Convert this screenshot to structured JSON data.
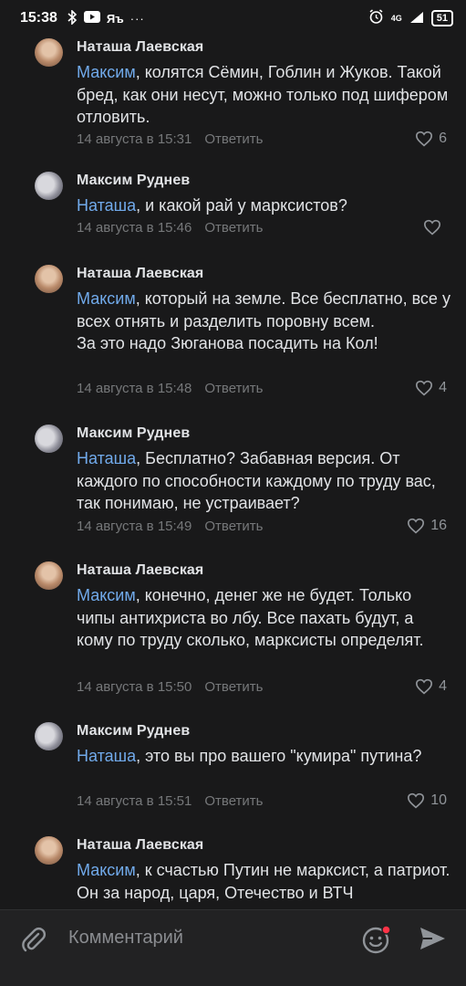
{
  "status_bar": {
    "time": "15:38",
    "icons_left": [
      "bluetooth-icon",
      "youtube-icon",
      "yandex-icon",
      "more-dots-icon"
    ],
    "network": "4G",
    "battery": "51"
  },
  "comments": [
    {
      "author": "Наташа Лаевская",
      "mention": "Максим",
      "text": ", колятся Сёмин, Гоблин и Жуков. Такой бред, как они несут, можно только под шифером отловить.",
      "time": "14 августа в 15:31",
      "reply": "Ответить",
      "likes": "6"
    },
    {
      "author": "Максим Руднев",
      "mention": "Наташа",
      "text": ", и какой рай у марксистов?",
      "time": "14 августа в 15:46",
      "reply": "Ответить",
      "likes": ""
    },
    {
      "author": "Наташа Лаевская",
      "mention": "Максим",
      "text": ", который на земле. Все бесплатно, все  у всех отнять и разделить поровну всем.\nЗа это надо Зюганова посадить на Кол!",
      "time": "14 августа в 15:48",
      "reply": "Ответить",
      "likes": "4"
    },
    {
      "author": "Максим Руднев",
      "mention": "Наташа",
      "text": ", Бесплатно? Забавная версия. От каждого по способности каждому по труду вас, так понимаю, не устраивает?",
      "time": "14 августа в 15:49",
      "reply": "Ответить",
      "likes": "16"
    },
    {
      "author": "Наташа Лаевская",
      "mention": "Максим",
      "text": ", конечно, денег же не будет. Только чипы антихриста во лбу. Все пахать будут, а кому по труду сколько, марксисты определят.",
      "time": "14 августа в 15:50",
      "reply": "Ответить",
      "likes": "4"
    },
    {
      "author": "Максим Руднев",
      "mention": "Наташа",
      "text": ", это вы про вашего \"кумира\" путина?",
      "time": "14 августа в 15:51",
      "reply": "Ответить",
      "likes": "10"
    },
    {
      "author": "Наташа Лаевская",
      "mention": "Максим",
      "text": ", к счастью Путин не марксист, а патриот. Он за народ, царя, Отечество и ВТЧ",
      "time": "",
      "reply": "",
      "likes": ""
    }
  ],
  "input": {
    "placeholder": "Комментарий"
  },
  "colors": {
    "background": "#19191a",
    "mention": "#71aaeb",
    "meta": "#76787a",
    "text": "#e1e3e6",
    "notification_dot": "#ff3347"
  }
}
